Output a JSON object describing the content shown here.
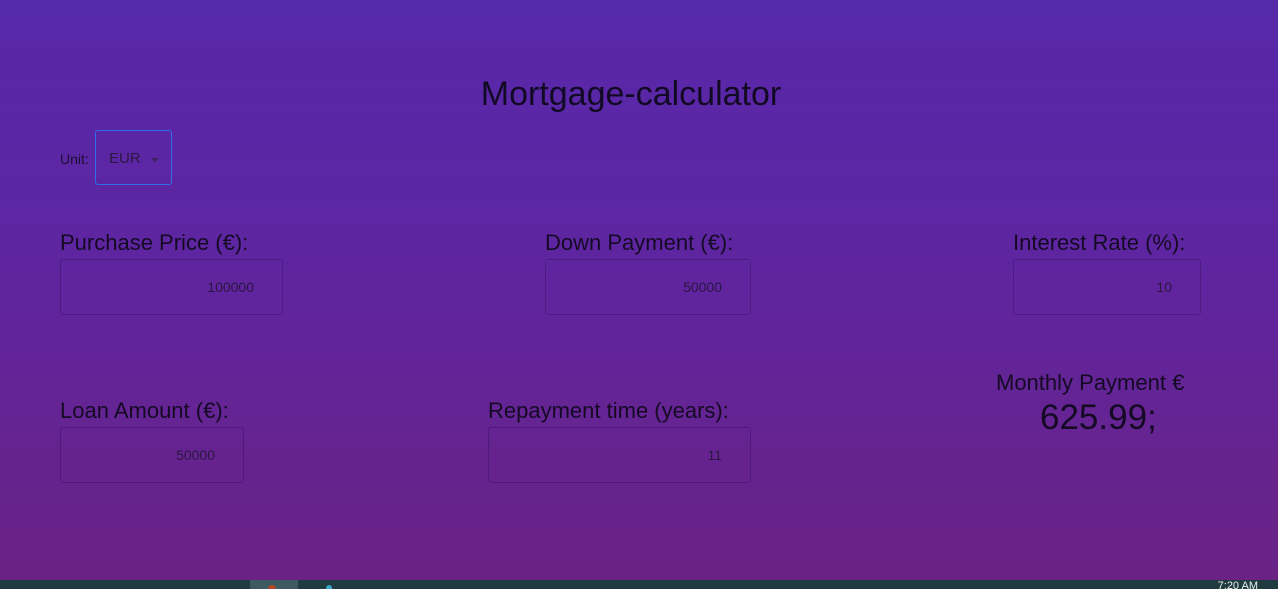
{
  "app": {
    "title": "Mortgage-calculator"
  },
  "unit": {
    "label": "Unit:",
    "selected": "EUR"
  },
  "fields": {
    "purchase_price": {
      "label": "Purchase Price (€):",
      "value": "100000"
    },
    "down_payment": {
      "label": "Down Payment (€):",
      "value": "50000"
    },
    "interest_rate": {
      "label": "Interest Rate (%):",
      "value": "10"
    },
    "loan_amount": {
      "label": "Loan Amount (€):",
      "value": "50000"
    },
    "repayment_time": {
      "label": "Repayment time (years):",
      "value": "11"
    }
  },
  "result": {
    "label": "Monthly Payment €",
    "value": "625.99;"
  },
  "taskbar": {
    "clock": "7:20 AM"
  },
  "colors": {
    "background_top": "#5628aa",
    "background_bottom": "#6a2284",
    "select_focus_border": "#2e6ee8",
    "taskbar": "#1f3b3f"
  }
}
